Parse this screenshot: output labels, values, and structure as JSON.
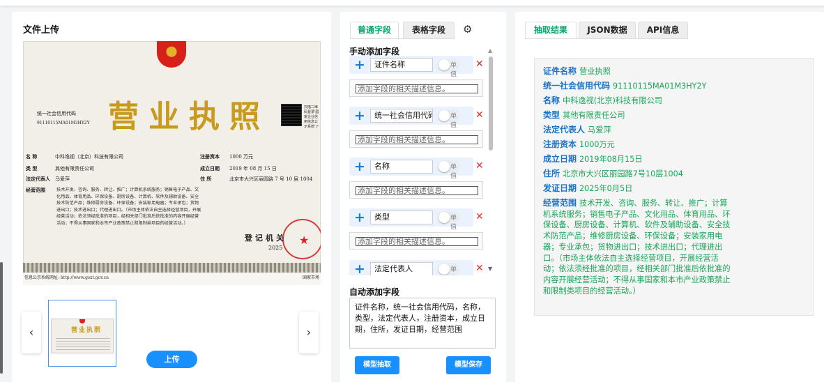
{
  "upload_panel": {
    "title": "文件上传",
    "upload_label": "上传",
    "license": {
      "big_title": "营业执照",
      "code_label": "统一社会信用代码",
      "code_value": "91110115MA01M3HY2Y",
      "qr_note": "扫描二维码登录'国家企业信用信息公示系统'了解更多登记、备案、许可、监管信息",
      "rows": [
        {
          "label": "名  称",
          "value": "中科逸视（北京）科技有限公司"
        },
        {
          "label": "类  型",
          "value": "其他有限责任公司"
        },
        {
          "label": "法定代表人",
          "value": "马爱萍"
        },
        {
          "label": "经营范围",
          "value": ""
        }
      ],
      "right_rows": [
        {
          "label": "注册资本",
          "value": "1000 万元"
        },
        {
          "label": "成立日期",
          "value": "2019 年 08 月 15 日"
        },
        {
          "label": "住  所",
          "value": "北京市大兴区丽园路 7 号 10 层 1004"
        }
      ],
      "scope": "技术开发、咨询、服务、转让、推广；计算机系统服务；销售电子产品、文化用品、体育用品、环保设备、厨房设备、计算机、软件及辅助设备、安全技术防范产品；维修厨房设备、环保设备；安装家用电器；专业承包；货物进出口；技术进出口；代理进出口。（市场主体依法自主选择经营项目，开展经营活动；依法须经批准的项目，经相关部门批准后依批准的内容开展经营活动；不得从事国家和本市产业政策禁止和限制类项目的经营活动。）",
      "authority": "登记机关",
      "year": "2025",
      "footer_left": "信息公示系统网址: http://www.gsxt.gov.cn",
      "footer_right": "国家市场"
    },
    "prev_icon": "chevron-left-icon",
    "next_icon": "chevron-right-icon",
    "prev_glyph": "‹",
    "next_glyph": "›"
  },
  "field_panel": {
    "tabs": [
      {
        "label": "普通字段",
        "active": true
      },
      {
        "label": "表格字段",
        "active": false
      }
    ],
    "gear_glyph": "⚙",
    "manual_label": "手动添加字段",
    "single_value_label": "单值",
    "desc_placeholder": "添加字段的相关描述信息。",
    "fields": [
      {
        "name": "证件名称"
      },
      {
        "name": "统一社会信用代码"
      },
      {
        "name": "名称"
      },
      {
        "name": "类型"
      },
      {
        "name": "法定代表人"
      }
    ],
    "auto_label": "自动添加字段",
    "auto_text": "证件名称，统一社会信用代码，名称，类型，法定代表人，注册资本，成立日期，住所，发证日期，经营范围",
    "extract_button": "模型抽取",
    "save_button": "模型保存",
    "accent_color": "#0aa46e",
    "button_color": "#1890ff"
  },
  "result_panel": {
    "tabs": [
      {
        "label": "抽取结果",
        "active": true
      },
      {
        "label": "JSON数据",
        "active": false
      },
      {
        "label": "API信息",
        "active": false
      }
    ],
    "results": [
      {
        "key": "证件名称",
        "value": "营业执照"
      },
      {
        "key": "统一社会信用代码",
        "value": "91110115MA01M3HY2Y"
      },
      {
        "key": "名称",
        "value": "中科逸视(北京)科技有限公司"
      },
      {
        "key": "类型",
        "value": "其他有限责任公司"
      },
      {
        "key": "法定代表人",
        "value": "马爱萍"
      },
      {
        "key": "注册资本",
        "value": "1000万元"
      },
      {
        "key": "成立日期",
        "value": "2019年08月15日"
      },
      {
        "key": "住所",
        "value": "北京市大兴区丽园路7号10层1004"
      },
      {
        "key": "发证日期",
        "value": "2025年0月5日"
      },
      {
        "key": "经营范围",
        "value": "技术开发、咨询、服务、转让、推广；计算机系统服务；销售电子产品、文化用品、体育用品、环保设备、厨房设备、计算机、软件及辅助设备、安全技术防范产品；维修厨房设备、环保设备；安装家用电器；专业承包；货物进出口；技术进出口；代理进出口。（市场主体依法自主选择经营项目，开展经营活动；依法须经批准的项目，经相关部门批准后依批准的内容开展经营活动；不得从事国家和本市产业政策禁止和限制类项目的经营活动。）"
      }
    ],
    "key_color": "#1a73c8",
    "value_color": "#18a558"
  }
}
